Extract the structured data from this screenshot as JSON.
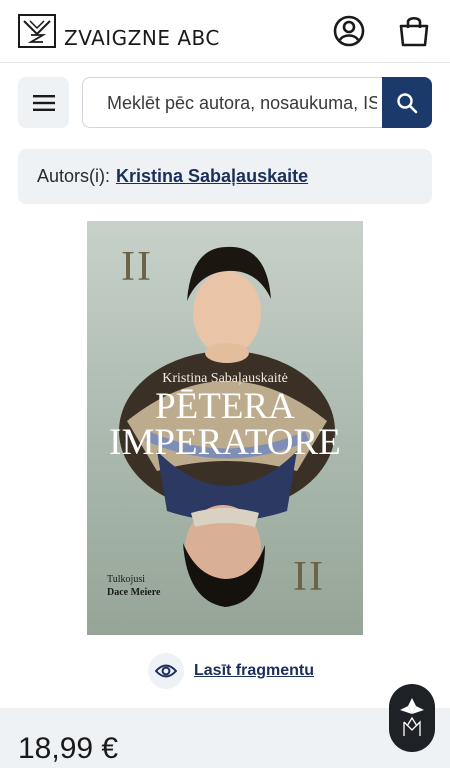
{
  "header": {
    "logo_text": "ZVAIGZNE ABC",
    "icons": {
      "account": "user-circle-icon",
      "cart": "shopping-bag-icon"
    }
  },
  "search": {
    "placeholder": "Meklēt pēc autora, nosaukuma, ISBN",
    "menu_icon": "hamburger-menu-icon",
    "search_icon": "search-icon"
  },
  "author": {
    "prefix": "Autors(i):",
    "name": "Kristina Sabaļauskaite"
  },
  "cover": {
    "volume": "II",
    "author": "Kristina Sabaļauskaitė",
    "title_line1": "PĒTERA",
    "title_line2": "IMPERATORE",
    "translator_label": "Tulkojusi",
    "translator_name": "Dace Meiere"
  },
  "fragment": {
    "label": "Lasīt fragmentu",
    "icon": "eye-icon"
  },
  "price": {
    "value": "18,99 €"
  },
  "colors": {
    "accent": "#1b3a6b",
    "panel": "#eef2f5",
    "badge": "#1e2126"
  }
}
